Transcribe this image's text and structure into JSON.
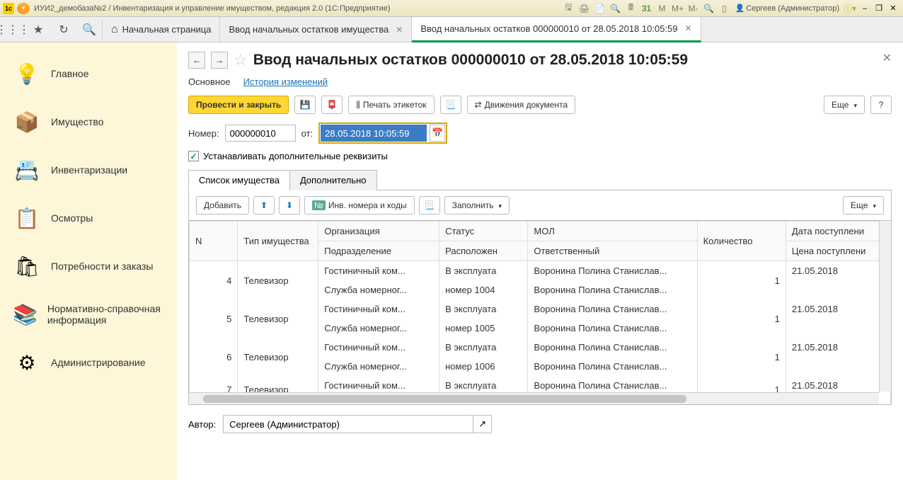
{
  "titlebar": {
    "title": "ИУИ2_демобаза№2 / Инвентаризация и управление имуществом, редакция 2.0  (1С:Предприятие)",
    "user": "Сергеев (Администратор)",
    "m_labels": [
      "M",
      "M+",
      "M-"
    ],
    "calendar_day": "31"
  },
  "tabstrip": {
    "home": "Начальная страница",
    "tabs": [
      {
        "label": "Ввод начальных остатков имущества",
        "active": false
      },
      {
        "label": "Ввод начальных остатков 000000010 от 28.05.2018 10:05:59",
        "active": true
      }
    ]
  },
  "sidebar": [
    {
      "icon": "💡",
      "label": "Главное"
    },
    {
      "icon": "📦",
      "label": "Имущество"
    },
    {
      "icon": "📇",
      "label": "Инвентаризации"
    },
    {
      "icon": "📋",
      "label": "Осмотры"
    },
    {
      "icon": "🛍",
      "label": "Потребности и заказы"
    },
    {
      "icon": "📚",
      "label": "Нормативно-справочная информация"
    },
    {
      "icon": "⚙",
      "label": "Администрирование"
    }
  ],
  "page": {
    "title": "Ввод начальных остатков 000000010 от 28.05.2018 10:05:59",
    "tabs": {
      "main": "Основное",
      "history": "История изменений"
    },
    "toolbar": {
      "post_close": "Провести и закрыть",
      "print_labels": "Печать этикеток",
      "doc_moves": "Движения документа",
      "more": "Еще"
    },
    "form": {
      "number_label": "Номер:",
      "number_value": "000000010",
      "date_label": "от:",
      "date_value": "28.05.2018 10:05:59",
      "checkbox_label": "Устанавливать дополнительные реквизиты",
      "checkbox_checked": true
    },
    "grid_tabs": {
      "list": "Список имущества",
      "extra": "Дополнительно"
    },
    "grid_toolbar": {
      "add": "Добавить",
      "inv_numbers": "Инв. номера и коды",
      "fill": "Заполнить",
      "more": "Еще"
    },
    "grid_headers": {
      "n": "N",
      "type": "Тип имущества",
      "org": "Организация",
      "org_sub": "Подразделение",
      "status": "Статус",
      "status_sub": "Расположен",
      "mol": "МОЛ",
      "mol_sub": "Ответственный",
      "qty": "Количество",
      "date": "Дата поступлени",
      "price": "Цена поступлени"
    },
    "grid_rows": [
      {
        "n": "4",
        "type": "Телевизор",
        "org": "Гостиничный ком...",
        "org_sub": "Служба номерног...",
        "status": "В эксплуата",
        "status_sub": "номер 1004",
        "mol": "Воронина Полина Станислав...",
        "mol_sub": "Воронина Полина Станислав...",
        "qty": "1",
        "date": "21.05.2018"
      },
      {
        "n": "5",
        "type": "Телевизор",
        "org": "Гостиничный ком...",
        "org_sub": "Служба номерног...",
        "status": "В эксплуата",
        "status_sub": "номер 1005",
        "mol": "Воронина Полина Станислав...",
        "mol_sub": "Воронина Полина Станислав...",
        "qty": "1",
        "date": "21.05.2018"
      },
      {
        "n": "6",
        "type": "Телевизор",
        "org": "Гостиничный ком...",
        "org_sub": "Служба номерног...",
        "status": "В эксплуата",
        "status_sub": "номер 1006",
        "mol": "Воронина Полина Станислав...",
        "mol_sub": "Воронина Полина Станислав...",
        "qty": "1",
        "date": "21.05.2018"
      },
      {
        "n": "7",
        "type": "Телевизор",
        "org": "Гостиничный ком...",
        "org_sub": "",
        "status": "В эксплуата",
        "status_sub": "",
        "mol": "Воронина Полина Станислав...",
        "mol_sub": "",
        "qty": "1",
        "date": "21.05.2018"
      }
    ],
    "footer": {
      "author_label": "Автор:",
      "author_value": "Сергеев (Администратор)"
    }
  }
}
